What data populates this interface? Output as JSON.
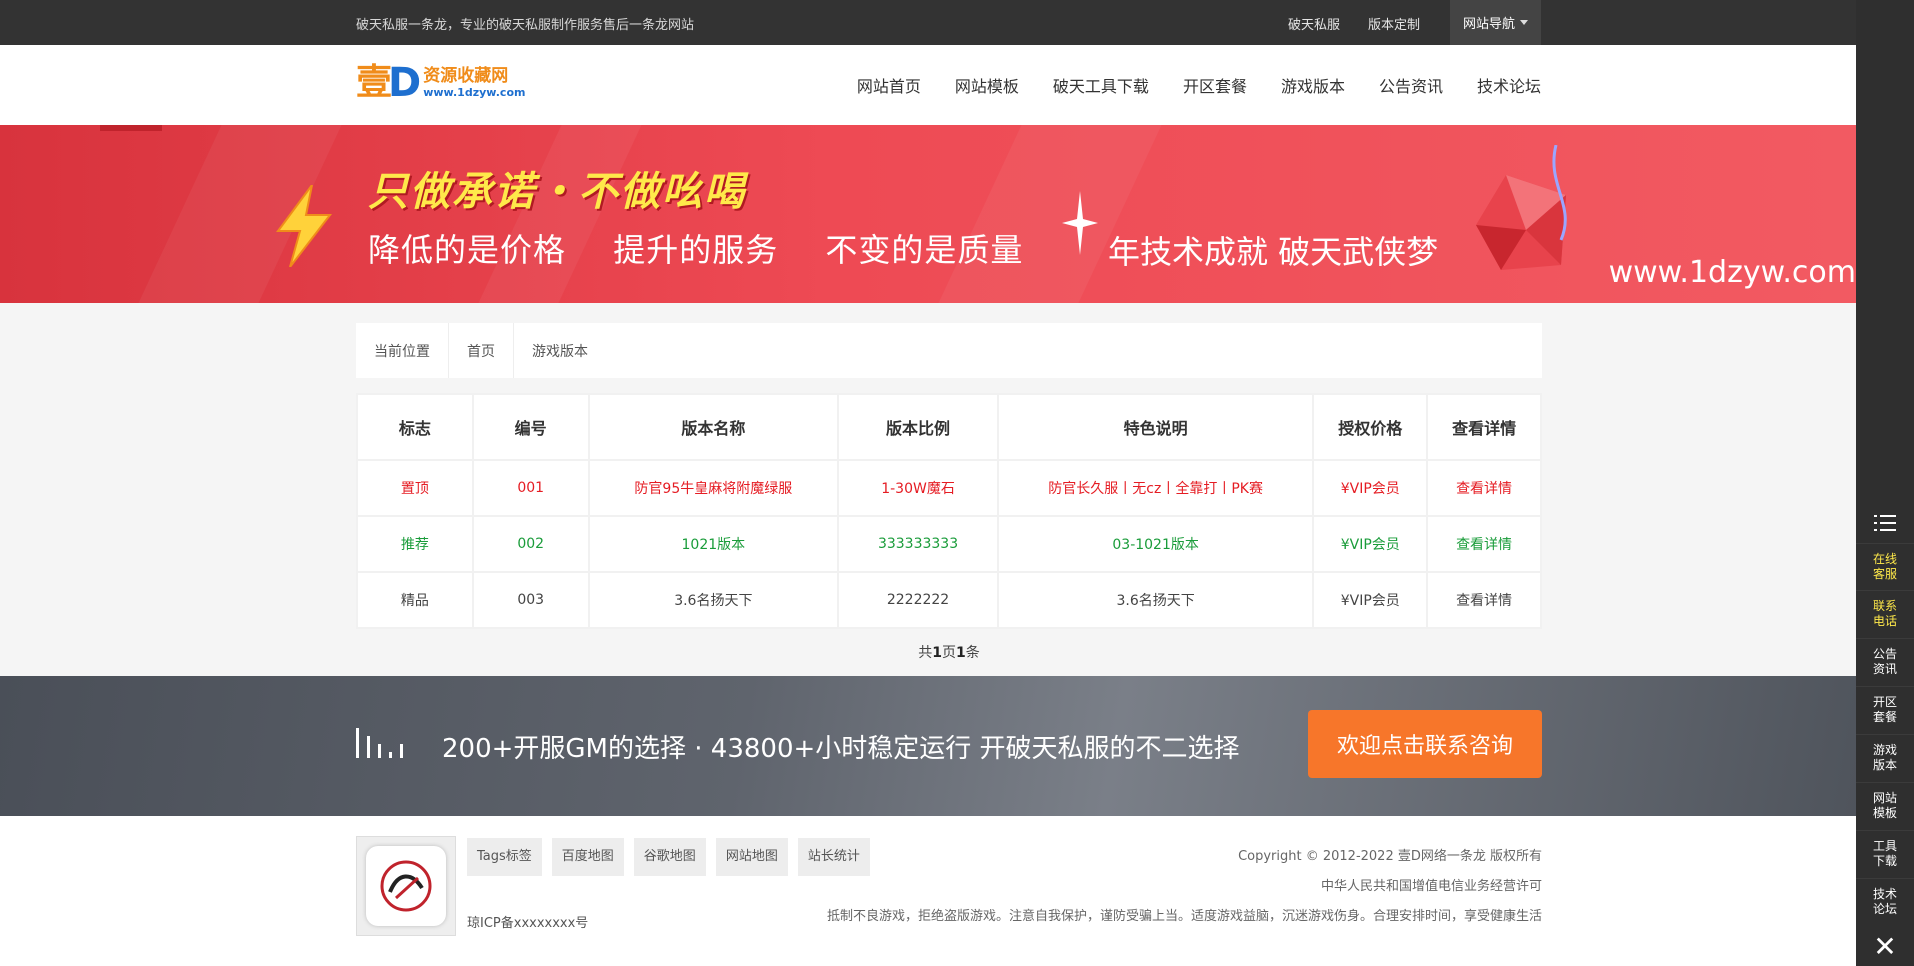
{
  "topbar": {
    "tagline": "破天私服一条龙，专业的破天私服制作服务售后一条龙网站",
    "links": [
      "破天私服",
      "版本定制"
    ],
    "nav_dropdown": "网站导航"
  },
  "logo": {
    "big": "壹",
    "mark": "D",
    "cn": "资源收藏网",
    "url": "www.1dzyw.com"
  },
  "nav": [
    "网站首页",
    "网站模板",
    "破天工具下载",
    "开区套餐",
    "游戏版本",
    "公告资讯",
    "技术论坛"
  ],
  "banner": {
    "slogan": "只做承诺・不做吆喝",
    "sub": [
      "降低的是价格",
      "提升的服务",
      "不变的是质量"
    ],
    "year_text": "年技术成就 破天武侠梦",
    "url": "www.1dzyw.com"
  },
  "breadcrumb": [
    "当前位置",
    "首页",
    "游戏版本"
  ],
  "table": {
    "headers": [
      "标志",
      "编号",
      "版本名称",
      "版本比例",
      "特色说明",
      "授权价格",
      "查看详情"
    ],
    "rows": [
      [
        "置顶",
        "001",
        "防官95牛皇麻将附魔绿服",
        "1-30W魔石",
        "防官长久服丨无cz丨全靠打丨PK赛",
        "¥VIP会员",
        "查看详情"
      ],
      [
        "推荐",
        "002",
        "1021版本",
        "333333333",
        "03-1021版本",
        "¥VIP会员",
        "查看详情"
      ],
      [
        "精品",
        "003",
        "3.6名扬天下",
        "2222222",
        "3.6名扬天下",
        "¥VIP会员",
        "查看详情"
      ]
    ]
  },
  "pager": {
    "pre": "共",
    "pages": "1",
    "mid": "页",
    "count": "1",
    "post": "条"
  },
  "promo": {
    "text": "200+开服GM的选择 · 43800+小时稳定运行 开破天私服的不二选择",
    "cta": "欢迎点击联系咨询"
  },
  "footer": {
    "links": [
      "Tags标签",
      "百度地图",
      "谷歌地图",
      "网站地图",
      "站长统计"
    ],
    "icp": "琼ICP备xxxxxxxx号",
    "copyright": "Copyright © 2012-2022 壹D网络一条龙 版权所有",
    "license": "中华人民共和国增值电信业务经营许可",
    "notice": "抵制不良游戏，拒绝盗版游戏。注意自我保护，谨防受骗上当。适度游戏益脑，沉迷游戏伤身。合理安排时间，享受健康生活"
  },
  "sidebar": {
    "items": [
      "在线客服",
      "联系电话",
      "公告资讯",
      "开区套餐",
      "游戏版本",
      "网站模板",
      "工具下载",
      "技术论坛"
    ],
    "accent_color": "#ffe94a"
  }
}
